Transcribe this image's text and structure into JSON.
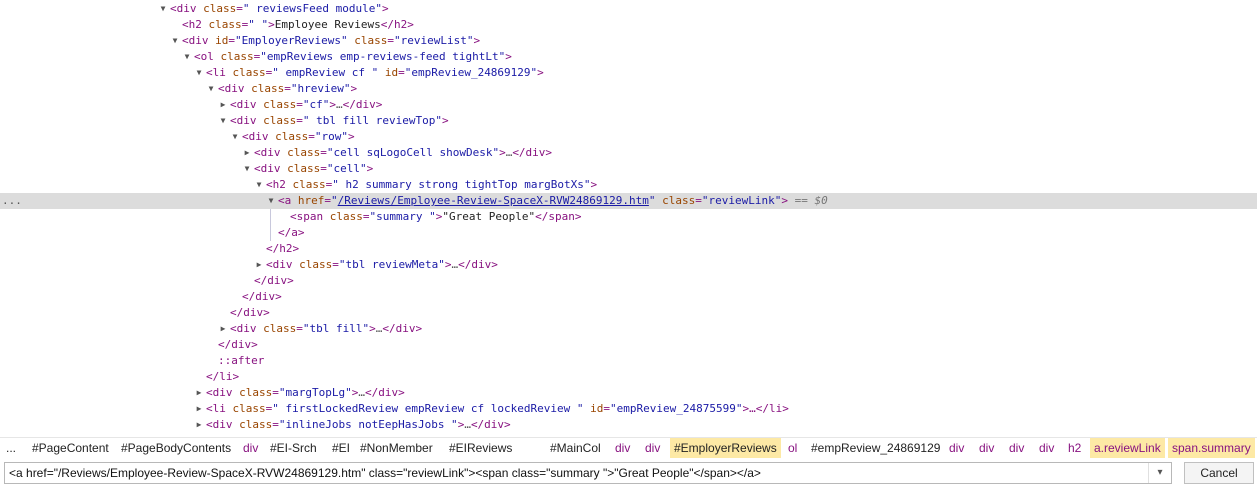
{
  "dom": {
    "n0": {
      "tag": "div",
      "attr": "class",
      "val": "\" reviewsFeed module\""
    },
    "n1": {
      "open": "<h2 ",
      "attr": "class",
      "val": "\" \"",
      "text": "Employee Reviews",
      "close": "</h2>"
    },
    "n2": {
      "open": "<div ",
      "attr1": "id",
      "val1": "\"EmployerReviews\"",
      "attr2": "class",
      "val2": "\"reviewList\"",
      "close": ">"
    },
    "n3": {
      "tag": "ol",
      "attr": "class",
      "val": "\"empReviews emp-reviews-feed tightLt\""
    },
    "n4": {
      "open": "<li ",
      "attr1": "class",
      "val1": "\" empReview cf \"",
      "attr2": "id",
      "val2": "\"empReview_24869129\"",
      "close": ">"
    },
    "n5": {
      "tag": "div",
      "attr": "class",
      "val": "\"hreview\""
    },
    "n6": {
      "tag": "div",
      "attr": "class",
      "val": "\"cf\"",
      "ellipsis": "…",
      "close": "</div>"
    },
    "n7": {
      "tag": "div",
      "attr": "class",
      "val": "\" tbl fill reviewTop\""
    },
    "n8": {
      "tag": "div",
      "attr": "class",
      "val": "\"row\""
    },
    "n9": {
      "tag": "div",
      "attr": "class",
      "val": "\"cell sqLogoCell showDesk\"",
      "ellipsis": "…",
      "close": "</div>"
    },
    "n10": {
      "tag": "div",
      "attr": "class",
      "val": "\"cell\""
    },
    "n11": {
      "tag": "h2",
      "attr": "class",
      "val": "\" h2 summary strong tightTop margBotXs\""
    },
    "n12": {
      "open": "<a ",
      "attr1": "href",
      "href": "/Reviews/Employee-Review-SpaceX-RVW24869129.htm",
      "attr2": "class",
      "val2": "\"reviewLink\"",
      "close": ">",
      "eq0": "== $0"
    },
    "n13": {
      "open": "<span ",
      "attr": "class",
      "val": "\"summary \"",
      "text": "\"Great People\"",
      "close": "</span>"
    },
    "n14": "</a>",
    "n15": "</h2>",
    "n16": {
      "tag": "div",
      "attr": "class",
      "val": "\"tbl reviewMeta\"",
      "ellipsis": "…",
      "close": "</div>"
    },
    "n17": "</div>",
    "n18": "</div>",
    "n19": "</div>",
    "n20": {
      "tag": "div",
      "attr": "class",
      "val": "\"tbl fill\"",
      "ellipsis": "…",
      "close": "</div>"
    },
    "n21": "</div>",
    "n22": "::after",
    "n23": "</li>",
    "n24": {
      "tag": "div",
      "attr": "class",
      "val": "\"margTopLg\"",
      "ellipsis": "…",
      "close": "</div>"
    },
    "n25": {
      "open": "<li ",
      "attr1": "class",
      "val1": "\" firstLockedReview empReview cf lockedReview \"",
      "attr2": "id",
      "val2": "\"empReview_24875599\"",
      "close": ">…</li>"
    },
    "n26": {
      "tag": "div",
      "attr": "class",
      "val": "\"inlineJobs notEepHasJobs \"",
      "ellipsis": "…",
      "close": "</div>"
    }
  },
  "sel_dots": "...",
  "breadcrumbs": {
    "more": "...",
    "items": [
      "#PageContent",
      "#PageBodyContents",
      "div",
      "#EI-Srch",
      "#EI",
      "#NonMember",
      "#EIReviews",
      "#MainCol",
      "div",
      "div",
      "#EmployerReviews",
      "ol",
      "#empReview_24869129",
      "div",
      "div",
      "div",
      "div",
      "h2",
      "a.reviewLink",
      "span.summary"
    ]
  },
  "editor": {
    "value": "<a href=\"/Reviews/Employee-Review-SpaceX-RVW24869129.htm\" class=\"reviewLink\"><span class=\"summary \">\"Great People\"</span></a>",
    "dropdown_icon": "chevron-down-icon",
    "cancel_label": "Cancel"
  }
}
